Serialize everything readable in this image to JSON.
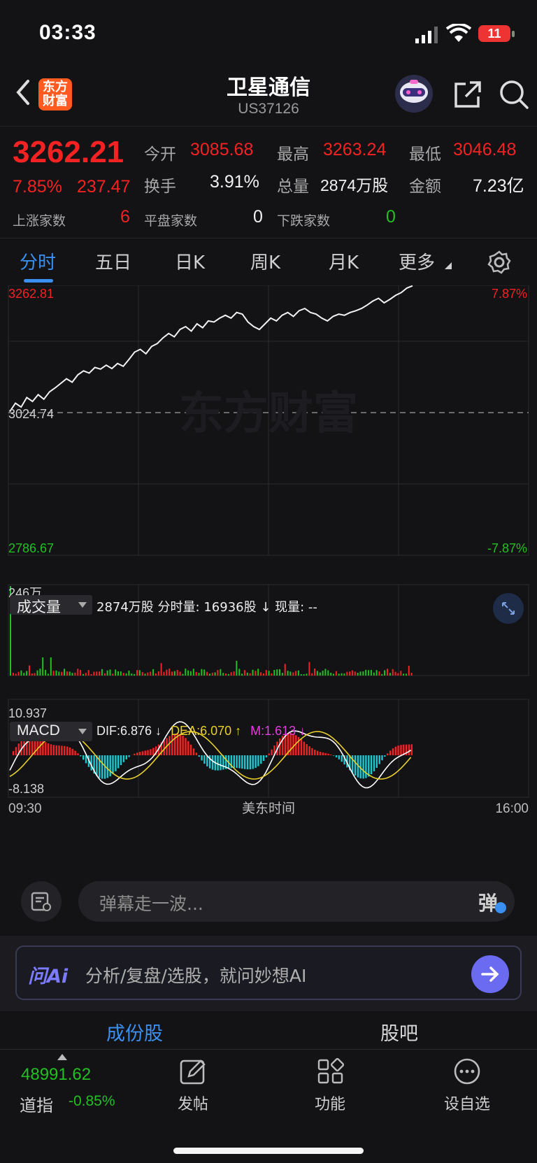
{
  "status": {
    "time": "03:33",
    "battery": "11"
  },
  "header": {
    "logo_line1": "东方",
    "logo_line2": "财富",
    "title": "卫星通信",
    "code": "US37126"
  },
  "quote": {
    "price": "3262.21",
    "pct": "7.85%",
    "change": "237.47",
    "open_label": "今开",
    "open": "3085.68",
    "high_label": "最高",
    "high": "3263.24",
    "low_label": "最低",
    "low": "3046.48",
    "turnover_label": "换手",
    "turnover": "3.91%",
    "volume_label": "总量",
    "volume": "2874万股",
    "amount_label": "金额",
    "amount": "7.23亿",
    "up_label": "上涨家数",
    "up": "6",
    "flat_label": "平盘家数",
    "flat": "0",
    "down_label": "下跌家数",
    "down": "0"
  },
  "tabs": [
    "分时",
    "五日",
    "日K",
    "周K",
    "月K",
    "更多"
  ],
  "chart_data": [
    {
      "type": "line",
      "title": "分时",
      "y_max_label": "3262.81",
      "y_mid_label": "3024.74",
      "y_min_label": "2786.67",
      "pct_max_label": "7.87%",
      "pct_min_label": "-7.87%",
      "ylim": [
        2786.67,
        3262.81
      ],
      "x_start": "09:30",
      "x_end": "16:00",
      "x_center_label": "美东时间",
      "watermark": "东方财富",
      "series": [
        {
          "name": "",
          "color": "#ffffff",
          "values": [
            3040,
            3055,
            3048,
            3065,
            3058,
            3070,
            3062,
            3075,
            3082,
            3090,
            3098,
            3092,
            3105,
            3112,
            3108,
            3118,
            3115,
            3122,
            3116,
            3125,
            3120,
            3132,
            3145,
            3150,
            3142,
            3155,
            3160,
            3170,
            3178,
            3172,
            3185,
            3190,
            3182,
            3195,
            3188,
            3200,
            3198,
            3205,
            3210,
            3205,
            3215,
            3212,
            3198,
            3190,
            3185,
            3195,
            3205,
            3200,
            3210,
            3215,
            3208,
            3218,
            3222,
            3215,
            3212,
            3205,
            3200,
            3208,
            3212,
            3210,
            3215,
            3218,
            3222,
            3228,
            3235,
            3240,
            3232,
            3238,
            3245,
            3250,
            3258,
            3262
          ]
        }
      ]
    },
    {
      "type": "bar",
      "title": "成交量",
      "total_label": "2874万股",
      "minute_label": "分时量: 16936股 ↓",
      "now_label": "现量: --",
      "y_max_label": "246万",
      "ylim": [
        0,
        246
      ]
    },
    {
      "type": "bar",
      "title": "MACD",
      "dif_label": "DIF:6.876 ↓",
      "dea_label": "DEA:6.070 ↑",
      "m_label": "M:1.613 ↓",
      "y_max_label": "10.937",
      "y_min_label": "-8.138",
      "ylim": [
        -8.138,
        10.937
      ]
    }
  ],
  "comment": {
    "placeholder": "弹幕走一波...",
    "danmu": "弹"
  },
  "ai": {
    "logo": "问Ai",
    "text": "分析/复盘/选股，就问妙想AI"
  },
  "sections": [
    "成份股",
    "股吧"
  ],
  "bottom": {
    "index_value": "48991.62",
    "index_name": "道指",
    "index_pct": "-0.85%",
    "nav": [
      "发帖",
      "功能",
      "设自选"
    ]
  },
  "colors": {
    "up": "#f42222",
    "down": "#22c022",
    "accent": "#3a8ff0",
    "macd_neg": "#1ec8d0",
    "dea": "#e8d02a",
    "m": "#e23de0"
  }
}
